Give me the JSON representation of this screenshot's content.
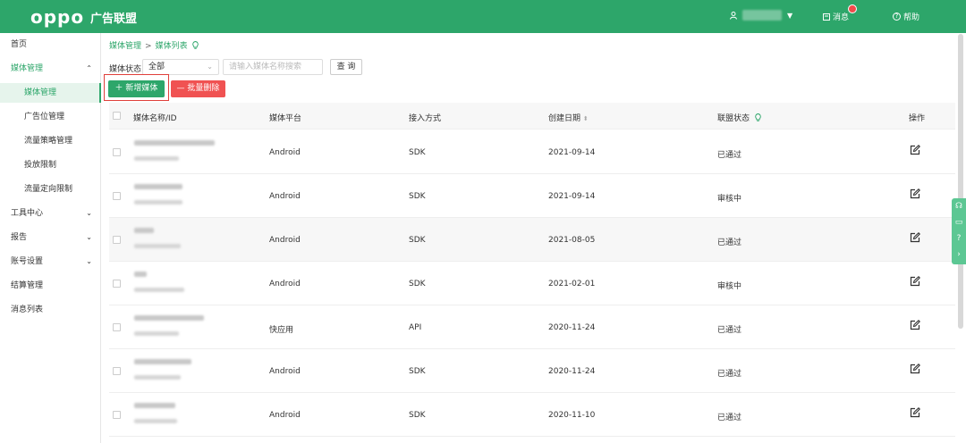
{
  "header": {
    "logo": "oppo",
    "brand": "广告联盟",
    "user_icon": "user-icon",
    "messages_label": "消息",
    "help_label": "帮助"
  },
  "sidebar": {
    "items": [
      {
        "label": "首页"
      },
      {
        "label": "媒体管理",
        "arrow": "⌃"
      },
      {
        "label": "媒体管理"
      },
      {
        "label": "广告位管理"
      },
      {
        "label": "流量策略管理"
      },
      {
        "label": "投放限制"
      },
      {
        "label": "流量定向限制"
      },
      {
        "label": "工具中心",
        "arrow": "⌄"
      },
      {
        "label": "报告",
        "arrow": "⌄"
      },
      {
        "label": "账号设置",
        "arrow": "⌄"
      },
      {
        "label": "结算管理"
      },
      {
        "label": "消息列表"
      }
    ]
  },
  "breadcrumb": {
    "parent": "媒体管理",
    "separator": ">",
    "current": "媒体列表"
  },
  "filter": {
    "status_label": "媒体状态",
    "status_value": "全部",
    "search_placeholder": "请输入媒体名称搜索",
    "query_label": "查 询"
  },
  "actions": {
    "add_label": "新增媒体",
    "delete_label": "批量删除"
  },
  "table": {
    "headers": {
      "name": "媒体名称/ID",
      "platform": "媒体平台",
      "access": "接入方式",
      "created": "创建日期",
      "status": "联盟状态",
      "op": "操作"
    },
    "rows": [
      {
        "platform": "Android",
        "access": "SDK",
        "created": "2021-09-14",
        "status": "已通过"
      },
      {
        "platform": "Android",
        "access": "SDK",
        "created": "2021-09-14",
        "status": "审核中"
      },
      {
        "platform": "Android",
        "access": "SDK",
        "created": "2021-08-05",
        "status": "已通过"
      },
      {
        "platform": "Android",
        "access": "SDK",
        "created": "2021-02-01",
        "status": "审核中"
      },
      {
        "platform": "快应用",
        "access": "API",
        "created": "2020-11-24",
        "status": "已通过"
      },
      {
        "platform": "Android",
        "access": "SDK",
        "created": "2020-11-24",
        "status": "已通过"
      },
      {
        "platform": "Android",
        "access": "SDK",
        "created": "2020-11-10",
        "status": "已通过"
      }
    ]
  },
  "colors": {
    "brand_green": "#2da66a",
    "danger_red": "#f05252",
    "highlight_red": "#e0403b"
  }
}
